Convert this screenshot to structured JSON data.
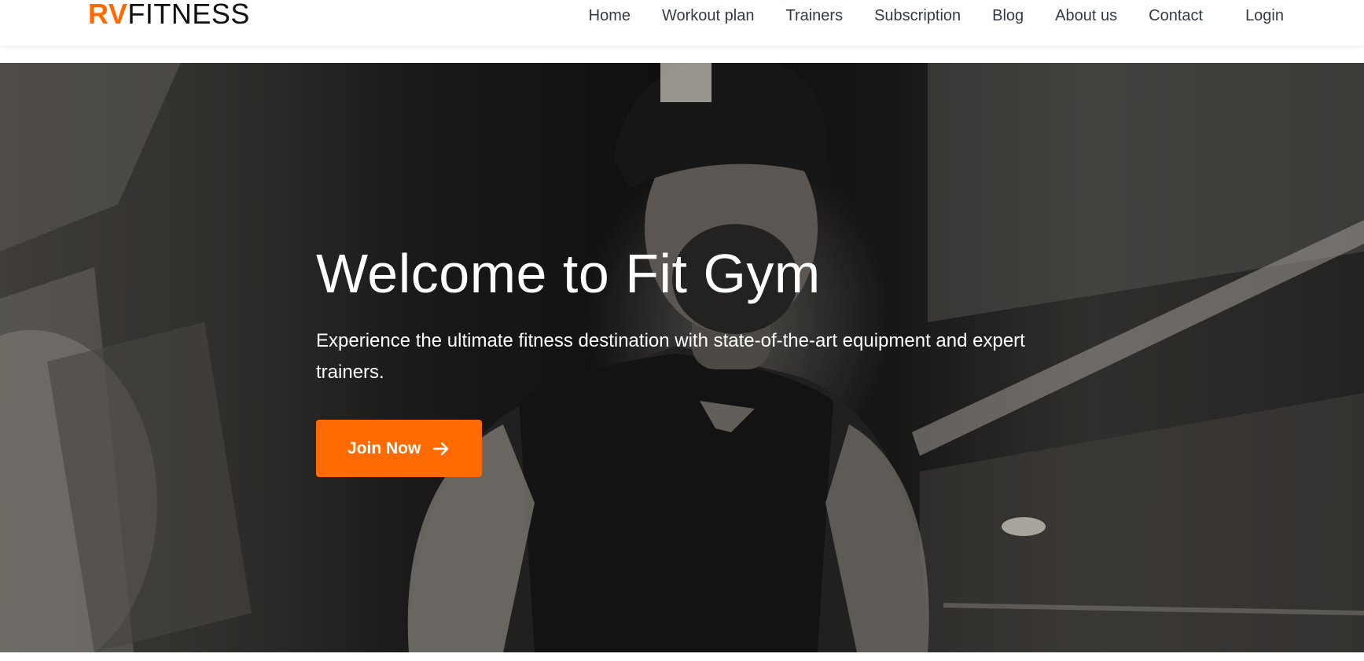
{
  "brand": {
    "accent": "RV",
    "name": "FITNESS",
    "accent_color": "#ff6b00"
  },
  "nav": {
    "items": [
      {
        "label": "Home"
      },
      {
        "label": "Workout plan"
      },
      {
        "label": "Trainers"
      },
      {
        "label": "Subscription"
      },
      {
        "label": "Blog"
      },
      {
        "label": "About us"
      },
      {
        "label": "Contact"
      }
    ],
    "login_label": "Login"
  },
  "hero": {
    "title": "Welcome to Fit Gym",
    "subtitle": "Experience the ultimate fitness destination with state-of-the-art equipment and expert trainers.",
    "cta_label": "Join Now",
    "cta_icon": "arrow-right-icon",
    "cta_color": "#ff6b00",
    "background_image": "black-and-white photo of a man in a cap and sleeveless shirt in a gym"
  }
}
